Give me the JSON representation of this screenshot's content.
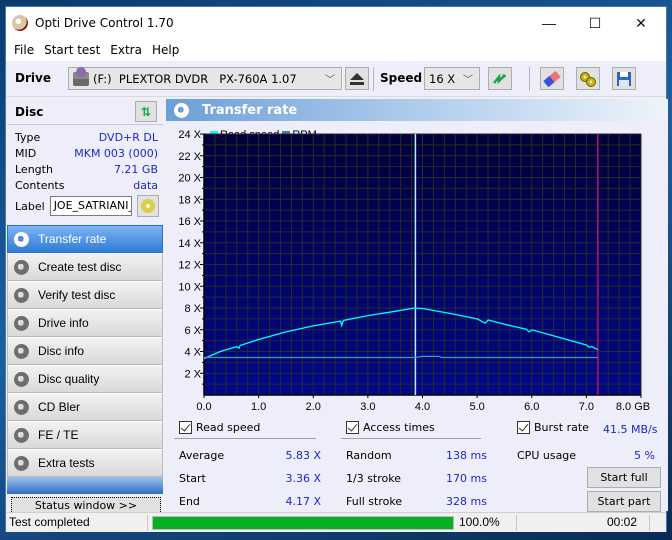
{
  "window": {
    "title": "Opti Drive Control 1.70",
    "controls": {
      "minimize": "—",
      "maximize": "☐",
      "close": "✕"
    }
  },
  "menu": [
    "File",
    "Start test",
    "Extra",
    "Help"
  ],
  "toolbar": {
    "drive_label": "Drive",
    "drive_value": "(F:)  PLEXTOR DVDR   PX-760A 1.07",
    "speed_label": "Speed",
    "speed_value": "16 X",
    "icons": [
      "eject-icon",
      "refresh-icon",
      "eraser-icon",
      "settings-icon",
      "save-icon"
    ]
  },
  "disc": {
    "title": "Disc",
    "rows": [
      {
        "key": "Type",
        "value": "DVD+R DL"
      },
      {
        "key": "MID",
        "value": "MKM 003 (000)"
      },
      {
        "key": "Length",
        "value": "7.21 GB"
      },
      {
        "key": "Contents",
        "value": "data"
      }
    ],
    "label_key": "Label",
    "label_value": "JOE_SATRIANI_"
  },
  "nav": [
    {
      "label": "Transfer rate",
      "active": true
    },
    {
      "label": "Create test disc",
      "active": false
    },
    {
      "label": "Verify test disc",
      "active": false
    },
    {
      "label": "Drive info",
      "active": false
    },
    {
      "label": "Disc info",
      "active": false
    },
    {
      "label": "Disc quality",
      "active": false
    },
    {
      "label": "CD Bler",
      "active": false
    },
    {
      "label": "FE / TE",
      "active": false
    },
    {
      "label": "Extra tests",
      "active": false
    }
  ],
  "status_window_button": "Status window >>",
  "panel_title": "Transfer rate",
  "chart_data": {
    "type": "line",
    "title": "Transfer rate",
    "legend": [
      {
        "name": "Read speed",
        "color": "#00ffff"
      },
      {
        "name": "RPM",
        "color": "#3f8a84"
      }
    ],
    "legend_placement": "top-left",
    "xlabel": "GB",
    "ylabel": "X",
    "xlim": [
      0,
      8
    ],
    "ylim": [
      0,
      24
    ],
    "x_ticks": [
      "0.0",
      "1.0",
      "2.0",
      "3.0",
      "4.0",
      "5.0",
      "6.0",
      "7.0",
      "8.0 GB"
    ],
    "y_ticks": [
      "2 X",
      "4 X",
      "6 X",
      "8 X",
      "10 X",
      "12 X",
      "14 X",
      "16 X",
      "18 X",
      "20 X",
      "22 X",
      "24 X"
    ],
    "grid": true,
    "background": "#000066",
    "series": [
      {
        "name": "Read speed",
        "x": [
          0.0,
          0.3,
          0.6,
          0.64,
          0.66,
          1.0,
          1.5,
          2.0,
          2.5,
          2.52,
          2.55,
          3.0,
          3.5,
          3.85,
          4.0,
          4.5,
          5.0,
          5.15,
          5.2,
          5.5,
          5.9,
          5.95,
          6.0,
          6.5,
          7.0,
          7.05,
          7.1,
          7.21
        ],
        "y": [
          3.36,
          4.0,
          4.45,
          4.3,
          4.55,
          5.1,
          5.8,
          6.35,
          6.8,
          6.4,
          6.85,
          7.3,
          7.7,
          8.0,
          7.95,
          7.5,
          7.0,
          6.6,
          6.9,
          6.5,
          6.05,
          5.8,
          6.0,
          5.3,
          4.6,
          4.4,
          4.45,
          4.17
        ]
      },
      {
        "name": "RPM",
        "x": [
          0.0,
          3.85,
          4.0,
          4.3,
          4.35,
          7.21
        ],
        "y": [
          3.45,
          3.45,
          3.55,
          3.55,
          3.45,
          3.45
        ]
      }
    ],
    "markers": [
      {
        "name": "position-marker",
        "x": 3.87,
        "color": "#b0f0ff"
      },
      {
        "name": "disc-end-marker",
        "x": 7.21,
        "color": "#b0106a"
      }
    ]
  },
  "read_speed": {
    "header": "Read speed",
    "checked": true,
    "rows": [
      {
        "key": "Average",
        "value": "5.83 X"
      },
      {
        "key": "Start",
        "value": "3.36 X"
      },
      {
        "key": "End",
        "value": "4.17 X"
      }
    ]
  },
  "access_times": {
    "header": "Access times",
    "checked": true,
    "rows": [
      {
        "key": "Random",
        "value": "138 ms"
      },
      {
        "key": "1/3 stroke",
        "value": "170 ms"
      },
      {
        "key": "Full stroke",
        "value": "328 ms"
      }
    ]
  },
  "burst": {
    "header": "Burst rate",
    "checked": true,
    "value": "41.5 MB/s",
    "cpu_key": "CPU usage",
    "cpu_value": "5 %"
  },
  "buttons": {
    "start_full": "Start full",
    "start_part": "Start part"
  },
  "statusbar": {
    "text": "Test completed",
    "progress": 1.0,
    "percent": "100.0%",
    "elapsed": "00:02"
  }
}
